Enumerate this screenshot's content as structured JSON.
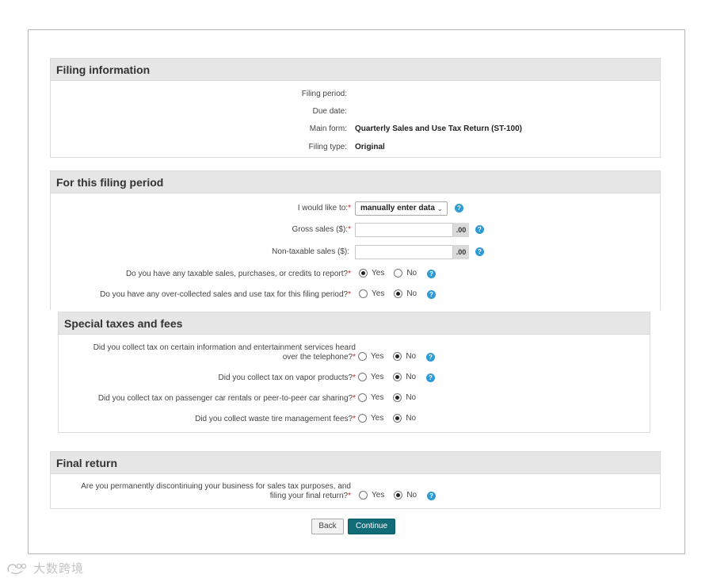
{
  "filing_info": {
    "title": "Filing information",
    "rows": [
      {
        "label": "Filing period:",
        "value": ""
      },
      {
        "label": "Due date:",
        "value": ""
      },
      {
        "label": "Main form:",
        "value": "Quarterly Sales and Use Tax Return (ST-100)"
      },
      {
        "label": "Filing type:",
        "value": "Original"
      }
    ]
  },
  "period": {
    "title": "For this filing period",
    "would_like_label": "I would like to:",
    "would_like_value": "manually enter data",
    "gross_label": "Gross sales ($):",
    "gross_cents": ".00",
    "nontax_label": "Non-taxable sales ($):",
    "nontax_cents": ".00",
    "q1_label": "Do you have any taxable sales, purchases, or credits to report?",
    "q2_label": "Do you have any over-collected sales and use tax for this filing period?"
  },
  "special": {
    "title": "Special taxes and fees",
    "q1_line1": "Did you collect tax on certain information and entertainment services heard",
    "q1_line2": "over the telephone?",
    "q2_label": "Did you collect tax on vapor products?",
    "q3_label": "Did you collect tax on passenger car rentals or peer-to-peer car sharing?",
    "q4_label": "Did you collect waste tire management fees?"
  },
  "final": {
    "title": "Final return",
    "q_line1": "Are you permanently discontinuing your business for sales tax purposes, and",
    "q_line2": "filing your final return?"
  },
  "common": {
    "required_mark": "*",
    "yes": "Yes",
    "no": "No",
    "help_glyph": "?",
    "chevron": "⌄"
  },
  "answers": {
    "period_q1": "Yes",
    "period_q2": "No",
    "special_q1": "No",
    "special_q2": "No",
    "special_q3": "No",
    "special_q4": "No",
    "final_q": "No"
  },
  "buttons": {
    "back": "Back",
    "continue": "Continue"
  },
  "watermark": {
    "text": "大数跨境"
  },
  "colors": {
    "header_bg": "#e6e6e6",
    "help_icon": "#2e9bd6",
    "required": "#c62828",
    "continue_bg": "#126c78"
  }
}
